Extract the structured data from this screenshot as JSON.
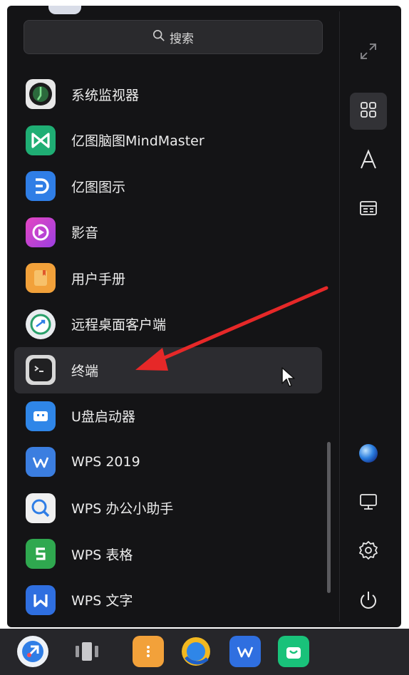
{
  "search": {
    "label": "搜索",
    "icon": "search-icon"
  },
  "apps": [
    {
      "label": "系统监视器",
      "icon": "system-monitor-icon",
      "color": "#1e1e1e"
    },
    {
      "label": "亿图脑图MindMaster",
      "icon": "mindmaster-icon",
      "color": "#1fae74"
    },
    {
      "label": "亿图图示",
      "icon": "edraw-icon",
      "color": "#2f7ee6"
    },
    {
      "label": "影音",
      "icon": "media-player-icon",
      "color": "#d63fb8"
    },
    {
      "label": "用户手册",
      "icon": "user-manual-icon",
      "color": "#f2a13a"
    },
    {
      "label": "远程桌面客户端",
      "icon": "remote-desktop-icon",
      "color": "#eaeaea"
    },
    {
      "label": "终端",
      "icon": "terminal-icon",
      "color": "#2a2a2a",
      "selected": true
    },
    {
      "label": "U盘启动器",
      "icon": "usb-launcher-icon",
      "color": "#2f86e8"
    },
    {
      "label": "WPS 2019",
      "icon": "wps-icon",
      "color": "#3b7ee0"
    },
    {
      "label": "WPS 办公小助手",
      "icon": "wps-assistant-icon",
      "color": "#f0f0f0"
    },
    {
      "label": "WPS 表格",
      "icon": "wps-spreadsheet-icon",
      "color": "#2fa84f"
    },
    {
      "label": "WPS 文字",
      "icon": "wps-writer-icon",
      "color": "#2f6fe0"
    }
  ],
  "sidebar": {
    "buttons": [
      {
        "name": "fullscreen-icon"
      },
      {
        "name": "grid-view-icon",
        "active": true
      },
      {
        "name": "letter-sort-icon"
      },
      {
        "name": "category-view-icon"
      },
      {
        "name": "browser-globe-icon"
      },
      {
        "name": "computer-icon"
      },
      {
        "name": "settings-icon"
      },
      {
        "name": "power-icon"
      }
    ]
  },
  "taskbar": {
    "icons": [
      "launcher-icon",
      "multitask-view-icon",
      "file-manager-icon",
      "browser-icon",
      "wps-taskbar-icon",
      "app-store-icon"
    ]
  },
  "colors": {
    "annotation_arrow": "#e62828",
    "panel_bg": "#141416",
    "selected_row": "#2c2c30"
  }
}
